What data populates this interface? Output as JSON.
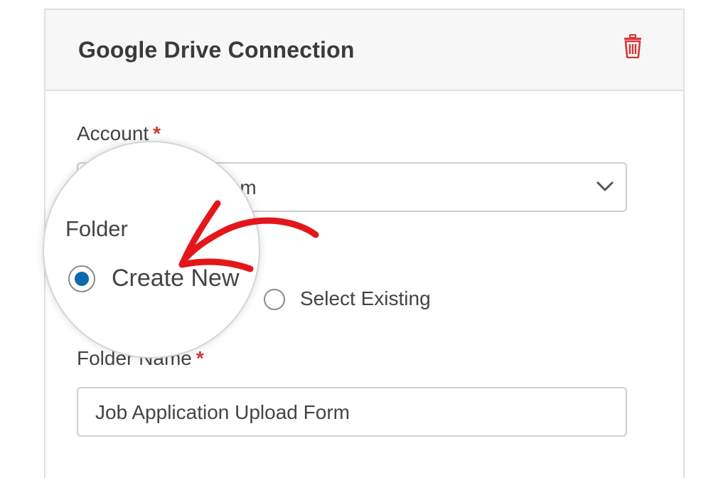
{
  "panel": {
    "title": "Google Drive Connection"
  },
  "account": {
    "label": "Account",
    "required_mark": "*",
    "value_visible": ".com"
  },
  "folder": {
    "label": "Folder",
    "options": [
      {
        "label": "Create New",
        "selected": true
      },
      {
        "label": "Select Existing",
        "selected": false
      }
    ]
  },
  "folder_name": {
    "label": "Folder Name",
    "required_mark": "*",
    "value": "Job Application Upload Form"
  },
  "colors": {
    "accent": "#0e6aa8",
    "required": "#d63638",
    "annotation_arrow": "#e4161b",
    "trash": "#d63638"
  },
  "icons": {
    "delete": "trash-icon",
    "dropdown": "chevron-down-icon"
  }
}
